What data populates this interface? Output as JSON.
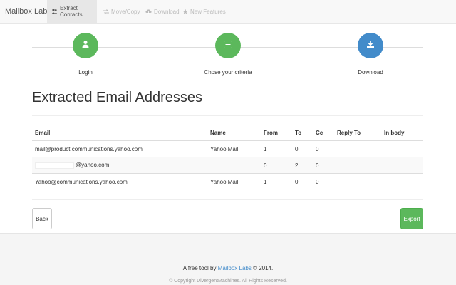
{
  "navbar": {
    "brand": "Mailbox Labs",
    "items": [
      {
        "label": "Extract Contacts",
        "icon": "users-icon",
        "active": true
      },
      {
        "label": "Move/Copy",
        "icon": "swap-arrows-icon",
        "active": false
      },
      {
        "label": "Download",
        "icon": "cloud-download-icon",
        "active": false
      },
      {
        "label": "New Features",
        "icon": "star-icon",
        "active": false
      }
    ]
  },
  "wizard": {
    "steps": [
      {
        "label": "Login",
        "icon": "user-icon",
        "color": "#5cb85c"
      },
      {
        "label": "Chose your criteria",
        "icon": "list-icon",
        "color": "#5cb85c"
      },
      {
        "label": "Download",
        "icon": "download-icon",
        "color": "#428bca"
      }
    ]
  },
  "page": {
    "title": "Extracted Email Addresses"
  },
  "table": {
    "columns": [
      "Email",
      "Name",
      "From",
      "To",
      "Cc",
      "Reply To",
      "In body"
    ],
    "rows": [
      {
        "email": "mail@product.communications.yahoo.com",
        "name": "Yahoo Mail",
        "from": "1",
        "to": "0",
        "cc": "0",
        "reply_to": "",
        "in_body": ""
      },
      {
        "email": "@yahoo.com",
        "name": "",
        "from": "0",
        "to": "2",
        "cc": "0",
        "reply_to": "",
        "in_body": ""
      },
      {
        "email": "Yahoo@communications.yahoo.com",
        "name": "Yahoo Mail",
        "from": "1",
        "to": "0",
        "cc": "0",
        "reply_to": "",
        "in_body": ""
      }
    ]
  },
  "actions": {
    "back_label": "Back",
    "export_label": "Export"
  },
  "footer": {
    "prefix": "A free tool by",
    "link": "Mailbox Labs",
    "suffix": "© 2014.",
    "copyright": "© Copyright DivergentMachines. All Rights Reserved."
  },
  "colors": {
    "success": "#5cb85c",
    "primary": "#428bca",
    "navbar_bg": "#f8f8f8",
    "footer_bg": "#f5f5f5"
  }
}
